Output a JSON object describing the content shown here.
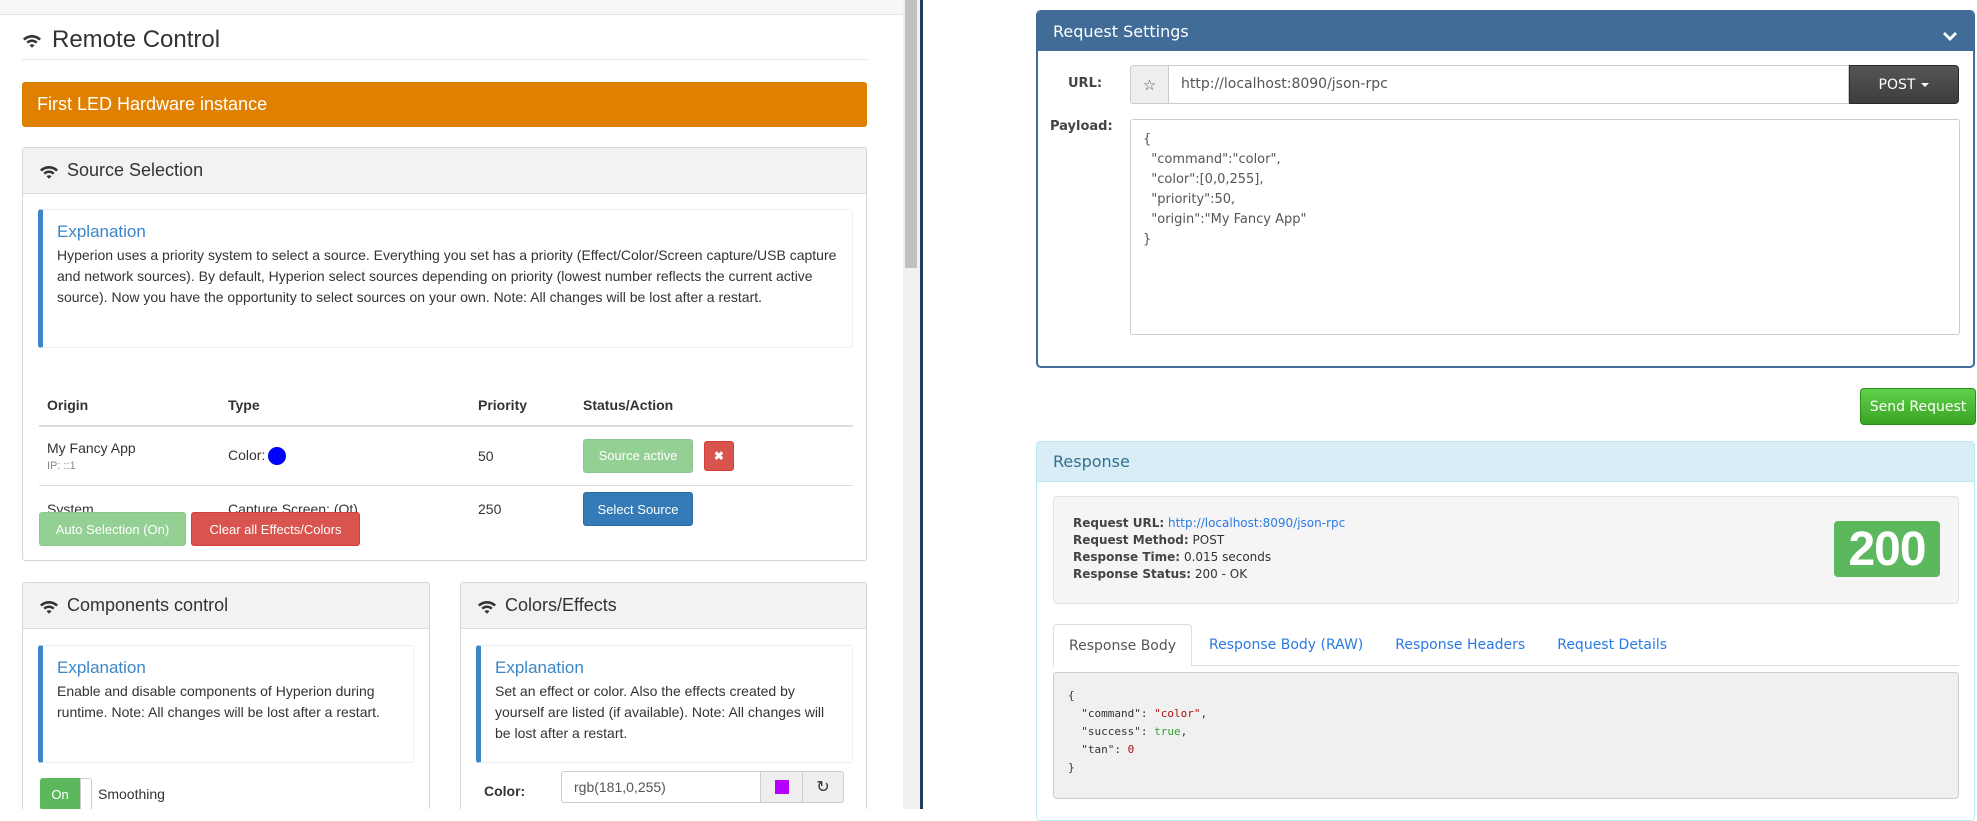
{
  "left": {
    "page_title": "Remote Control",
    "instance_banner": "First LED Hardware instance",
    "source_selection": {
      "title": "Source Selection",
      "explanation_title": "Explanation",
      "explanation_text": "Hyperion uses a priority system to select a source. Everything you set has a priority (Effect/Color/Screen capture/USB capture and network sources). By default, Hyperion select sources depending on priority (lowest number reflects the current active source). Now you have the opportunity to select sources on your own. Note: All changes will be lost after a restart.",
      "columns": [
        "Origin",
        "Type",
        "Priority",
        "Status/Action"
      ],
      "rows": [
        {
          "origin": "My Fancy App",
          "origin_sub": "IP: ::1",
          "type": "Color:",
          "color": "#0000ff",
          "priority": "50",
          "action": "Source active",
          "remove": "✖"
        },
        {
          "origin": "System",
          "origin_sub": "",
          "type": "Capture Screen: (Qt)",
          "priority": "250",
          "action": "Select Source"
        }
      ],
      "auto_selection_button": "Auto Selection (On)",
      "clear_all_button": "Clear all Effects/Colors"
    },
    "components": {
      "title": "Components control",
      "explanation_title": "Explanation",
      "explanation_text": "Enable and disable components of Hyperion during runtime. Note: All changes will be lost after a restart.",
      "toggle_state": "On",
      "toggle_label": "Smoothing"
    },
    "colors_effects": {
      "title": "Colors/Effects",
      "explanation_title": "Explanation",
      "explanation_text": "Set an effect or color. Also the effects created by yourself are listed (if available). Note: All changes will be lost after a restart.",
      "color_label": "Color:",
      "color_value": "rgb(181,0,255)",
      "swatch_color": "#b500ff"
    }
  },
  "right": {
    "request_settings": {
      "title": "Request Settings",
      "url_label": "URL:",
      "url_value": "http://localhost:8090/json-rpc",
      "method": "POST",
      "payload_label": "Payload:",
      "payload": "{\n  \"command\":\"color\",\n  \"color\":[0,0,255],\n  \"priority\":50,\n  \"origin\":\"My Fancy App\"\n}"
    },
    "send_button": "Send Request",
    "response": {
      "title": "Response",
      "request_url_label": "Request URL:",
      "request_url": "http://localhost:8090/json-rpc",
      "request_method_label": "Request Method:",
      "request_method": "POST",
      "response_time_label": "Response Time:",
      "response_time": "0.015 seconds",
      "response_status_label": "Response Status:",
      "response_status": "200 - OK",
      "status_code": "200",
      "tabs": [
        "Response Body",
        "Response Body (RAW)",
        "Response Headers",
        "Request Details"
      ],
      "active_tab": "Response Body",
      "body": {
        "open": "{",
        "lines": [
          {
            "key": "\"command\"",
            "value": "\"color\"",
            "kind": "s",
            "comma": ","
          },
          {
            "key": "\"success\"",
            "value": "true",
            "kind": "t",
            "comma": ","
          },
          {
            "key": "\"tan\"",
            "value": "0",
            "kind": "n",
            "comma": ""
          }
        ],
        "close": "}"
      }
    }
  }
}
